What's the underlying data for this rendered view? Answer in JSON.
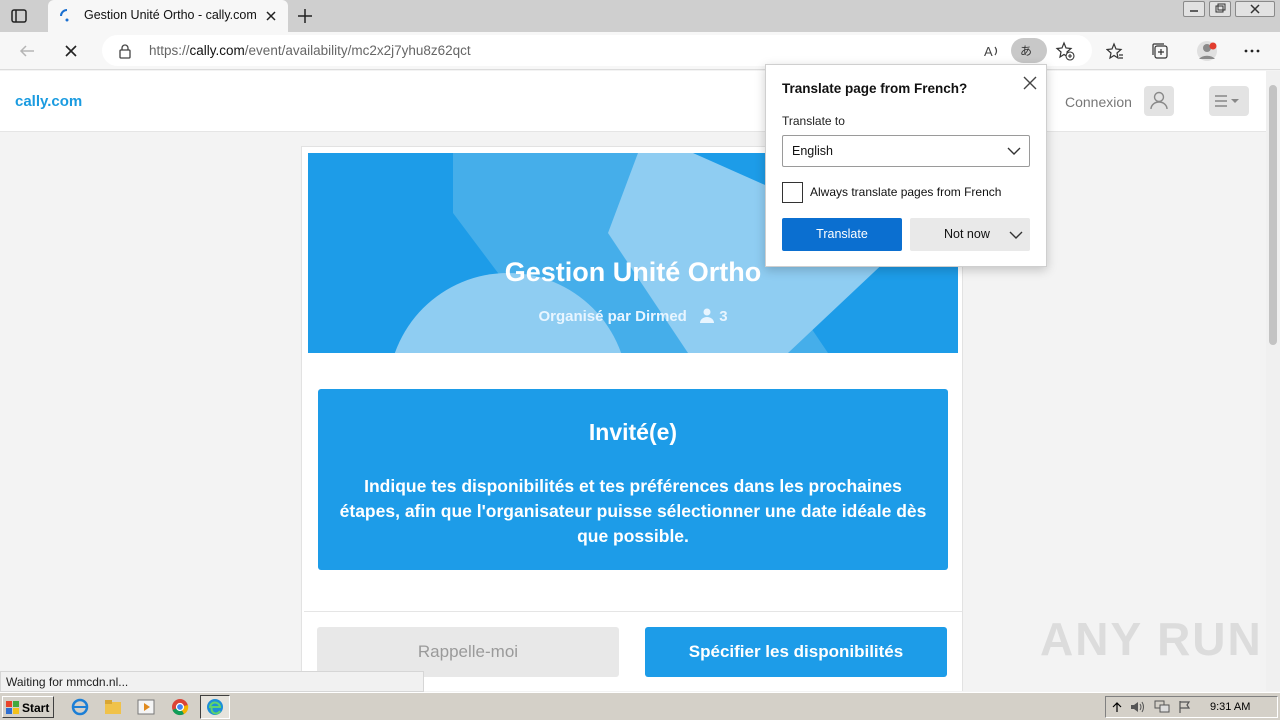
{
  "browser": {
    "tab_title": "Gestion Unité Ortho - cally.com",
    "url_prefix": "https://",
    "url_host": "cally.com",
    "url_path": "/event/availability/mc2x2j7yhu8z62qct",
    "translate_glyph": "あ",
    "status_text": "Waiting for mmcdn.nl..."
  },
  "site": {
    "logo": "cally.com",
    "login": "Connexion"
  },
  "event": {
    "title": "Gestion Unité Ortho",
    "organizer": "Organisé par Dirmed",
    "participants": "3"
  },
  "invite": {
    "title": "Invité(e)",
    "text": "Indique tes disponibilités et tes préférences dans les prochaines étapes, afin que l'organisateur puisse sélectionner une date idéale dès que possible."
  },
  "actions": {
    "remind": "Rappelle-moi",
    "specify": "Spécifier les disponibilités"
  },
  "translate_popup": {
    "title": "Translate page from French?",
    "translate_to_label": "Translate to",
    "selected_language": "English",
    "always_label": "Always translate pages from French",
    "always_checked": false,
    "translate_button": "Translate",
    "not_now_button": "Not now"
  },
  "watermark": "ANY RUN",
  "taskbar": {
    "start": "Start",
    "clock": "9:31 AM"
  },
  "colors": {
    "brand_blue": "#1d9ce8",
    "edge_blue": "#0b6fd0"
  }
}
